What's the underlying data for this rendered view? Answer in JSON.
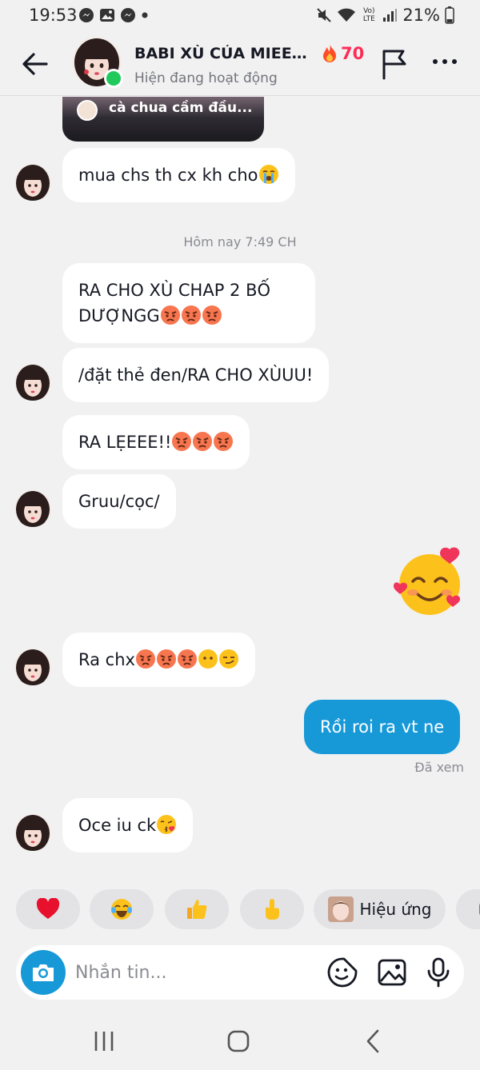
{
  "status_bar": {
    "time": "19:53",
    "battery": "21%",
    "volte": "Vo) LTE"
  },
  "header": {
    "contact_name": "BABI XÙ CỦA MIEE ...",
    "contact_status": "Hiện đang hoạt động",
    "streak_count": "70"
  },
  "chat": {
    "shared_video_caption": "cà chua cầm đầu...",
    "messages": [
      {
        "from": "them",
        "text": "mua chs th cx kh cho",
        "emojis": [
          "loudly-crying"
        ]
      },
      {
        "from": "them",
        "text": "RA CHO XÙ CHAP 2 BỐ DƯỢNGG",
        "emojis": [
          "angry",
          "angry",
          "angry"
        ]
      },
      {
        "from": "them",
        "text": "/đặt thẻ đen/RA CHO XÙUU!",
        "emojis": []
      },
      {
        "from": "them",
        "text": "RA LẸEEE!!",
        "emojis": [
          "angry",
          "angry",
          "angry"
        ]
      },
      {
        "from": "them",
        "text": "Gruu/cọc/",
        "emojis": []
      },
      {
        "from": "me",
        "text": "",
        "emojis": [
          "smiling-face-with-hearts"
        ]
      },
      {
        "from": "them",
        "text": "Ra chx",
        "emojis": [
          "angry",
          "angry",
          "angry",
          "no-mouth",
          "smirk"
        ]
      },
      {
        "from": "me",
        "text": "Rồi roi ra vt ne",
        "emojis": []
      },
      {
        "from": "them",
        "text": "Oce iu ck",
        "emojis": [
          "kiss"
        ]
      }
    ],
    "timestamp": "Hôm nay 7:49 CH",
    "seen_label": "Đã xem"
  },
  "quick_reactions": {
    "items": [
      "heart",
      "tears-of-joy",
      "thumbs-up",
      "pointing-up"
    ],
    "effects_label": "Hiệu ứng"
  },
  "composer": {
    "placeholder": "Nhắn tin..."
  },
  "colors": {
    "background": "#f1f1f2",
    "my_bubble": "#1799d8",
    "their_bubble": "#ffffff",
    "streak": "#fe2c55",
    "online": "#20c95b"
  }
}
